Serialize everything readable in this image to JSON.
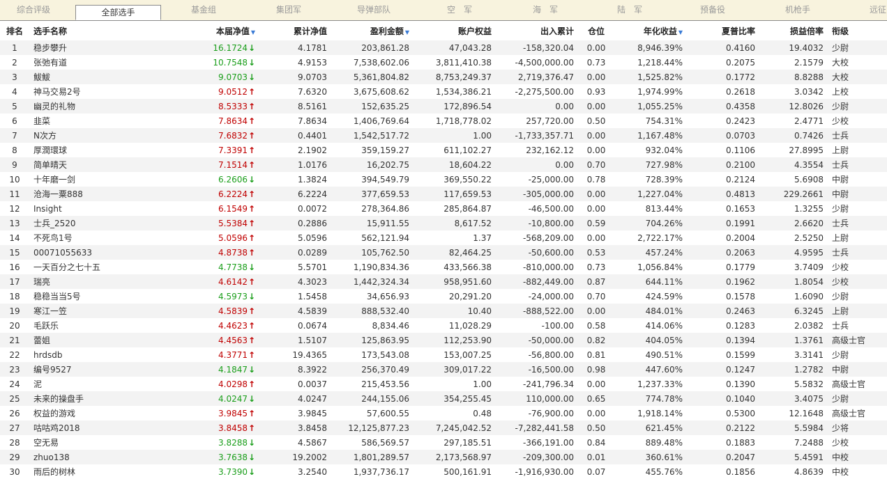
{
  "tabs": [
    "综合评级",
    "全部选手",
    "基金组",
    "集团军",
    "导弹部队",
    "空　军",
    "海　军",
    "陆　军",
    "预备役",
    "机枪手",
    "远征"
  ],
  "active_tab": 1,
  "headers": [
    "排名",
    "选手名称",
    "本届净值",
    "累计净值",
    "盈利金额",
    "账户权益",
    "出入累计",
    "仓位",
    "年化收益",
    "夏普比率",
    "损益倍率",
    "衔级"
  ],
  "sorted_columns": [
    2,
    4,
    8
  ],
  "rows": [
    [
      "1",
      "稳步攀升",
      "16.1724",
      "down",
      "4.1781",
      "203,861.28",
      "47,043.28",
      "-158,320.04",
      "0.00",
      "8,946.39%",
      "0.4160",
      "19.4032",
      "少尉"
    ],
    [
      "2",
      "张弛有道",
      "10.7548",
      "down",
      "4.9153",
      "7,538,602.06",
      "3,811,410.38",
      "-4,500,000.00",
      "0.73",
      "1,218.44%",
      "0.2075",
      "2.1579",
      "大校"
    ],
    [
      "3",
      "鮁鮁",
      "9.0703",
      "down",
      "9.0703",
      "5,361,804.82",
      "8,753,249.37",
      "2,719,376.47",
      "0.00",
      "1,525.82%",
      "0.1772",
      "8.8288",
      "大校"
    ],
    [
      "4",
      "神马交易2号",
      "9.0512",
      "up",
      "7.6320",
      "3,675,608.62",
      "1,534,386.21",
      "-2,275,500.00",
      "0.93",
      "1,974.99%",
      "0.2618",
      "3.0342",
      "上校"
    ],
    [
      "5",
      "幽灵的礼物",
      "8.5333",
      "up",
      "8.5161",
      "152,635.25",
      "172,896.54",
      "0.00",
      "0.00",
      "1,055.25%",
      "0.4358",
      "12.8026",
      "少尉"
    ],
    [
      "6",
      "韭菜",
      "7.8634",
      "up",
      "7.8634",
      "1,406,769.64",
      "1,718,778.02",
      "257,720.00",
      "0.50",
      "754.31%",
      "0.2423",
      "2.4771",
      "少校"
    ],
    [
      "7",
      "N次方",
      "7.6832",
      "up",
      "0.4401",
      "1,542,517.72",
      "1.00",
      "-1,733,357.71",
      "0.00",
      "1,167.48%",
      "0.0703",
      "0.7426",
      "士兵"
    ],
    [
      "8",
      "厚潤環球",
      "7.3391",
      "up",
      "2.1902",
      "359,159.27",
      "611,102.27",
      "232,162.12",
      "0.00",
      "932.04%",
      "0.1106",
      "27.8995",
      "上尉"
    ],
    [
      "9",
      "简单晴天",
      "7.1514",
      "up",
      "1.0176",
      "16,202.75",
      "18,604.22",
      "0.00",
      "0.70",
      "727.98%",
      "0.2100",
      "4.3554",
      "士兵"
    ],
    [
      "10",
      "十年磨一剑",
      "6.2606",
      "down",
      "1.3824",
      "394,549.79",
      "369,550.22",
      "-25,000.00",
      "0.78",
      "728.39%",
      "0.2124",
      "5.6908",
      "中尉"
    ],
    [
      "11",
      "沧海一粟888",
      "6.2224",
      "up",
      "6.2224",
      "377,659.53",
      "117,659.53",
      "-305,000.00",
      "0.00",
      "1,227.04%",
      "0.4813",
      "229.2661",
      "中尉"
    ],
    [
      "12",
      "Insight",
      "6.1549",
      "up",
      "0.0072",
      "278,364.86",
      "285,864.87",
      "-46,500.00",
      "0.00",
      "813.44%",
      "0.1653",
      "1.3255",
      "少尉"
    ],
    [
      "13",
      "士兵_2520",
      "5.5384",
      "up",
      "0.2886",
      "15,911.55",
      "8,617.52",
      "-10,800.00",
      "0.59",
      "704.26%",
      "0.1991",
      "2.6620",
      "士兵"
    ],
    [
      "14",
      "不死鸟1号",
      "5.0596",
      "up",
      "5.0596",
      "562,121.94",
      "1.37",
      "-568,209.00",
      "0.00",
      "2,722.17%",
      "0.2004",
      "2.5250",
      "上尉"
    ],
    [
      "15",
      "00071055633",
      "4.8738",
      "up",
      "0.0289",
      "105,762.50",
      "82,464.25",
      "-50,600.00",
      "0.53",
      "457.24%",
      "0.2063",
      "4.9595",
      "士兵"
    ],
    [
      "16",
      "一天百分之七十五",
      "4.7738",
      "down",
      "5.5701",
      "1,190,834.36",
      "433,566.38",
      "-810,000.00",
      "0.73",
      "1,056.84%",
      "0.1779",
      "3.7409",
      "少校"
    ],
    [
      "17",
      "瑞亮",
      "4.6142",
      "up",
      "4.3023",
      "1,442,324.34",
      "958,951.60",
      "-882,449.00",
      "0.87",
      "644.11%",
      "0.1962",
      "1.8054",
      "少校"
    ],
    [
      "18",
      "稳稳当当5号",
      "4.5973",
      "down",
      "1.5458",
      "34,656.93",
      "20,291.20",
      "-24,000.00",
      "0.70",
      "424.59%",
      "0.1578",
      "1.6090",
      "少尉"
    ],
    [
      "19",
      "寒江一笠",
      "4.5839",
      "up",
      "4.5839",
      "888,532.40",
      "10.40",
      "-888,522.00",
      "0.00",
      "484.01%",
      "0.2463",
      "6.3245",
      "上尉"
    ],
    [
      "20",
      "毛跃乐",
      "4.4623",
      "up",
      "0.0674",
      "8,834.46",
      "11,028.29",
      "-100.00",
      "0.58",
      "414.06%",
      "0.1283",
      "2.0382",
      "士兵"
    ],
    [
      "21",
      "蕾姐",
      "4.4563",
      "up",
      "1.5107",
      "125,863.95",
      "112,253.90",
      "-50,000.00",
      "0.82",
      "404.05%",
      "0.1394",
      "1.3761",
      "高级士官"
    ],
    [
      "22",
      "hrdsdb",
      "4.3771",
      "up",
      "19.4365",
      "173,543.08",
      "153,007.25",
      "-56,800.00",
      "0.81",
      "490.51%",
      "0.1599",
      "3.3141",
      "少尉"
    ],
    [
      "23",
      "编号9527",
      "4.1847",
      "down",
      "8.3922",
      "256,370.49",
      "309,017.22",
      "-16,500.00",
      "0.98",
      "447.60%",
      "0.1247",
      "1.2782",
      "中尉"
    ],
    [
      "24",
      "泥",
      "4.0298",
      "up",
      "0.0037",
      "215,453.56",
      "1.00",
      "-241,796.34",
      "0.00",
      "1,237.33%",
      "0.1390",
      "5.5832",
      "高级士官"
    ],
    [
      "25",
      "未来的操盘手",
      "4.0247",
      "down",
      "4.0247",
      "244,155.06",
      "354,255.45",
      "110,000.00",
      "0.65",
      "774.78%",
      "0.1040",
      "3.4075",
      "少尉"
    ],
    [
      "26",
      "权益的游戏",
      "3.9845",
      "up",
      "3.9845",
      "57,600.55",
      "0.48",
      "-76,900.00",
      "0.00",
      "1,918.14%",
      "0.5300",
      "12.1648",
      "高级士官"
    ],
    [
      "27",
      "咕咕鸡2018",
      "3.8458",
      "up",
      "3.8458",
      "12,125,877.23",
      "7,245,042.52",
      "-7,282,441.58",
      "0.50",
      "621.45%",
      "0.2122",
      "5.5984",
      "少将"
    ],
    [
      "28",
      "空无易",
      "3.8288",
      "down",
      "4.5867",
      "586,569.57",
      "297,185.51",
      "-366,191.00",
      "0.84",
      "889.48%",
      "0.1883",
      "7.2488",
      "少校"
    ],
    [
      "29",
      "zhuo138",
      "3.7638",
      "down",
      "19.2002",
      "1,801,289.57",
      "2,173,568.97",
      "-209,300.00",
      "0.01",
      "360.61%",
      "0.2047",
      "5.4591",
      "中校"
    ],
    [
      "30",
      "雨后的树林",
      "3.7390",
      "down",
      "3.2540",
      "1,937,736.17",
      "500,161.91",
      "-1,916,930.00",
      "0.07",
      "455.76%",
      "0.1856",
      "4.8639",
      "中校"
    ]
  ]
}
